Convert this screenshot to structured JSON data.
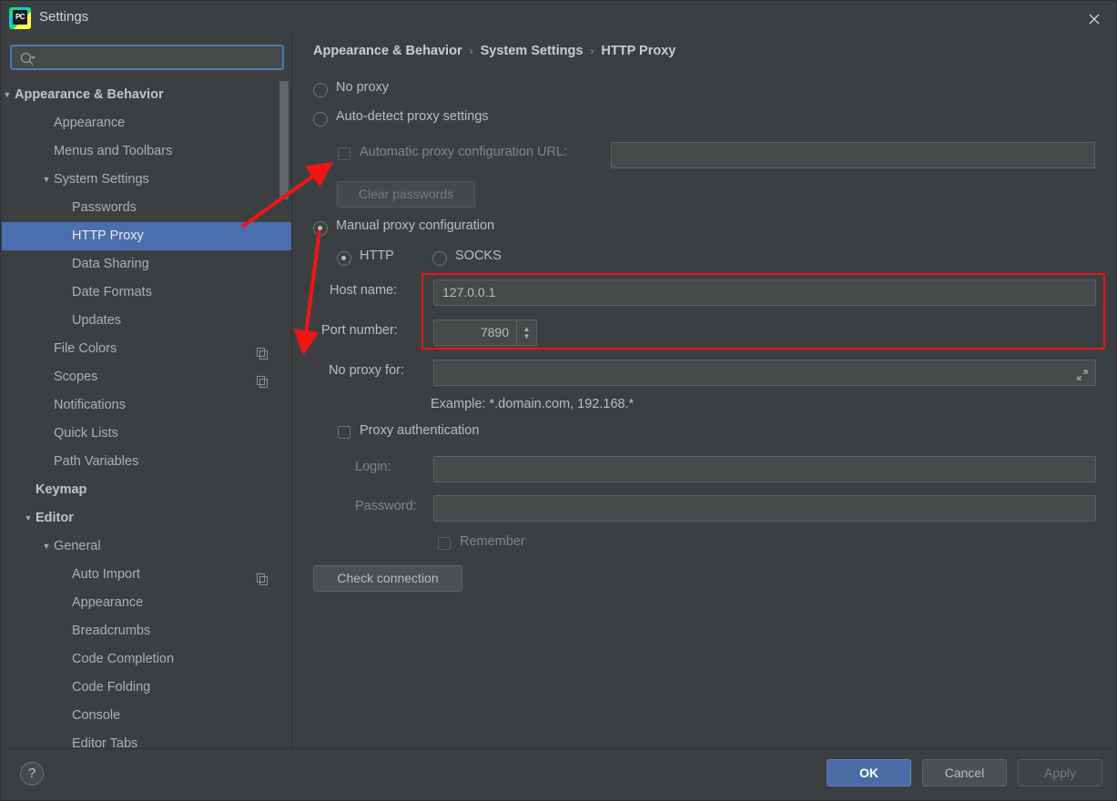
{
  "window": {
    "title": "Settings",
    "logo_text": "PC",
    "logo_icon": "pycharm-logo-icon",
    "close_icon": "close-icon"
  },
  "search": {
    "placeholder": "",
    "value": "",
    "icon": "search-icon"
  },
  "sidebar": {
    "items": [
      {
        "label": "Appearance & Behavior",
        "indent": 14,
        "arrow": "▼",
        "bold": true,
        "selected": false,
        "copy": false
      },
      {
        "label": "Appearance",
        "indent": 57,
        "arrow": "",
        "bold": false,
        "selected": false,
        "copy": false
      },
      {
        "label": "Menus and Toolbars",
        "indent": 57,
        "arrow": "",
        "bold": false,
        "selected": false,
        "copy": false
      },
      {
        "label": "System Settings",
        "indent": 57,
        "arrow": "▼",
        "bold": false,
        "selected": false,
        "copy": false
      },
      {
        "label": "Passwords",
        "indent": 77,
        "arrow": "",
        "bold": false,
        "selected": false,
        "copy": false
      },
      {
        "label": "HTTP Proxy",
        "indent": 77,
        "arrow": "",
        "bold": false,
        "selected": true,
        "copy": false
      },
      {
        "label": "Data Sharing",
        "indent": 77,
        "arrow": "",
        "bold": false,
        "selected": false,
        "copy": false
      },
      {
        "label": "Date Formats",
        "indent": 77,
        "arrow": "",
        "bold": false,
        "selected": false,
        "copy": false
      },
      {
        "label": "Updates",
        "indent": 77,
        "arrow": "",
        "bold": false,
        "selected": false,
        "copy": false
      },
      {
        "label": "File Colors",
        "indent": 57,
        "arrow": "",
        "bold": false,
        "selected": false,
        "copy": true
      },
      {
        "label": "Scopes",
        "indent": 57,
        "arrow": "",
        "bold": false,
        "selected": false,
        "copy": true
      },
      {
        "label": "Notifications",
        "indent": 57,
        "arrow": "",
        "bold": false,
        "selected": false,
        "copy": false
      },
      {
        "label": "Quick Lists",
        "indent": 57,
        "arrow": "",
        "bold": false,
        "selected": false,
        "copy": false
      },
      {
        "label": "Path Variables",
        "indent": 57,
        "arrow": "",
        "bold": false,
        "selected": false,
        "copy": false
      },
      {
        "label": "Keymap",
        "indent": 37,
        "arrow": "",
        "bold": true,
        "selected": false,
        "copy": false
      },
      {
        "label": "Editor",
        "indent": 37,
        "arrow": "▼",
        "bold": true,
        "selected": false,
        "copy": false
      },
      {
        "label": "General",
        "indent": 57,
        "arrow": "▼",
        "bold": false,
        "selected": false,
        "copy": false
      },
      {
        "label": "Auto Import",
        "indent": 77,
        "arrow": "",
        "bold": false,
        "selected": false,
        "copy": true
      },
      {
        "label": "Appearance",
        "indent": 77,
        "arrow": "",
        "bold": false,
        "selected": false,
        "copy": false
      },
      {
        "label": "Breadcrumbs",
        "indent": 77,
        "arrow": "",
        "bold": false,
        "selected": false,
        "copy": false
      },
      {
        "label": "Code Completion",
        "indent": 77,
        "arrow": "",
        "bold": false,
        "selected": false,
        "copy": false
      },
      {
        "label": "Code Folding",
        "indent": 77,
        "arrow": "",
        "bold": false,
        "selected": false,
        "copy": false
      },
      {
        "label": "Console",
        "indent": 77,
        "arrow": "",
        "bold": false,
        "selected": false,
        "copy": false
      },
      {
        "label": "Editor Tabs",
        "indent": 77,
        "arrow": "",
        "bold": false,
        "selected": false,
        "copy": false
      }
    ]
  },
  "breadcrumb": {
    "part1": "Appearance & Behavior",
    "sep1": "›",
    "part2": "System Settings",
    "sep2": "›",
    "part3": "HTTP Proxy"
  },
  "form": {
    "no_proxy_label": "No proxy",
    "no_proxy_selected": false,
    "auto_detect_label": "Auto-detect proxy settings",
    "auto_detect_selected": false,
    "auto_config_url_label": "Automatic proxy configuration URL:",
    "auto_config_url_checked": false,
    "auto_config_url_value": "",
    "clear_passwords_label": "Clear passwords",
    "manual_label": "Manual proxy configuration",
    "manual_selected": true,
    "http_label": "HTTP",
    "http_selected": true,
    "socks_label": "SOCKS",
    "socks_selected": false,
    "host_name_label": "Host name:",
    "host_name_value": "127.0.0.1",
    "port_number_label": "Port number:",
    "port_number_value": "7890",
    "no_proxy_for_label": "No proxy for:",
    "no_proxy_for_value": "",
    "expand_icon": "expand-icon",
    "example_text": "Example: *.domain.com, 192.168.*",
    "proxy_auth_label": "Proxy authentication",
    "proxy_auth_checked": false,
    "login_label": "Login:",
    "login_value": "",
    "password_label": "Password:",
    "password_value": "",
    "remember_label": "Remember",
    "remember_checked": false,
    "check_connection_label": "Check connection"
  },
  "footer": {
    "help_label": "?",
    "ok_label": "OK",
    "cancel_label": "Cancel",
    "apply_label": "Apply"
  },
  "colors": {
    "accent_blue": "#4b6eaf",
    "annotation_red": "#f01414",
    "window_bg": "#3c3f41",
    "field_bg": "#45494a"
  }
}
